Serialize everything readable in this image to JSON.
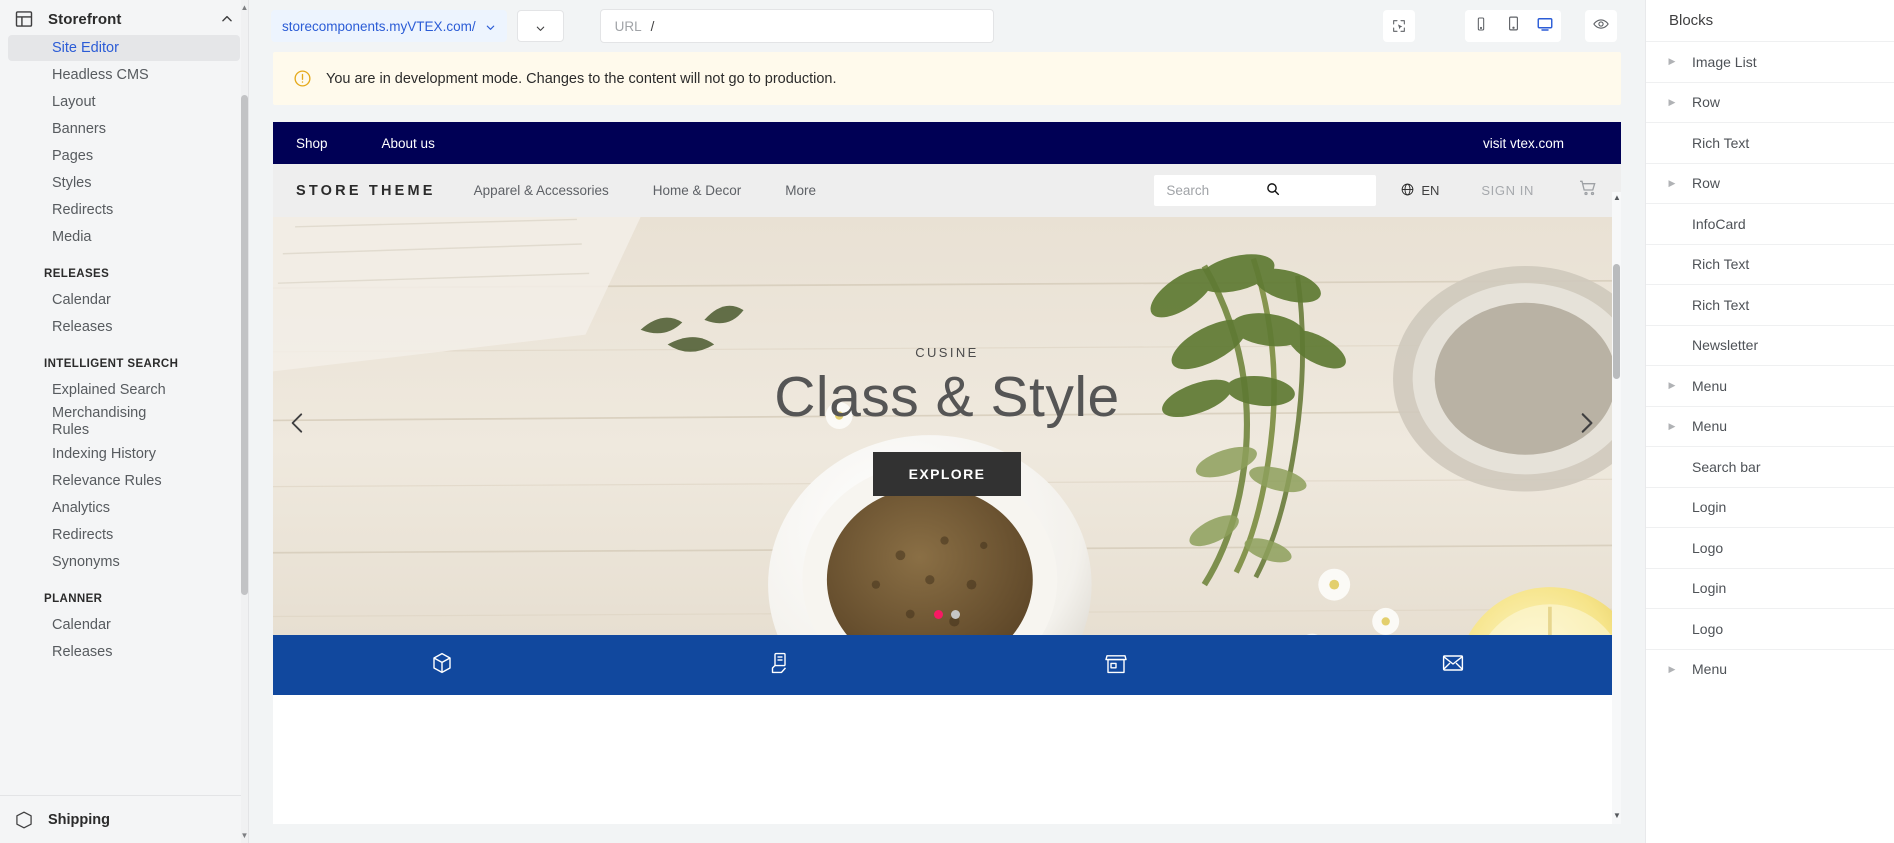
{
  "sidebar": {
    "header": {
      "title": "Storefront",
      "icon": "layout-icon",
      "collapse_icon": "chevron-up-icon"
    },
    "items": [
      {
        "label": "Site Editor",
        "active": true
      },
      {
        "label": "Headless CMS",
        "active": false
      },
      {
        "label": "Layout",
        "active": false
      },
      {
        "label": "Banners",
        "active": false
      },
      {
        "label": "Pages",
        "active": false
      },
      {
        "label": "Styles",
        "active": false
      },
      {
        "label": "Redirects",
        "active": false
      },
      {
        "label": "Media",
        "active": false
      }
    ],
    "groups": [
      {
        "title": "RELEASES",
        "items": [
          {
            "label": "Calendar"
          },
          {
            "label": "Releases"
          }
        ]
      },
      {
        "title": "INTELLIGENT SEARCH",
        "items": [
          {
            "label": "Explained Search"
          },
          {
            "label": "Merchandising Rules"
          },
          {
            "label": "Indexing History"
          },
          {
            "label": "Relevance Rules"
          },
          {
            "label": "Analytics"
          },
          {
            "label": "Redirects"
          },
          {
            "label": "Synonyms"
          }
        ]
      },
      {
        "title": "PLANNER",
        "items": [
          {
            "label": "Calendar"
          },
          {
            "label": "Releases"
          }
        ]
      }
    ],
    "bottom": {
      "label": "Shipping",
      "icon": "box-icon"
    }
  },
  "toolbar": {
    "store_account": "storecomponents.myVTEX.com/",
    "store_account_caret": "chevron-down-icon",
    "workspace_caret": "chevron-down-icon",
    "url_label": "URL",
    "url_value": "/",
    "url_placeholder": "URL",
    "select_tool_icon": "cursor-select-icon",
    "devices": [
      {
        "name": "phone-icon",
        "label": "Phone",
        "active": false
      },
      {
        "name": "tablet-icon",
        "label": "Tablet",
        "active": false
      },
      {
        "name": "desktop-icon",
        "label": "Desktop",
        "active": true
      }
    ],
    "preview_icon": "eye-icon",
    "accent_color": "#2b5cd6"
  },
  "dev_banner": {
    "icon": "warning-circle-icon",
    "text": "You are in development mode. Changes to the content will not go to production.",
    "bg_color": "#fffaec",
    "icon_color": "#e5a91a"
  },
  "preview": {
    "topnav": {
      "links": [
        "Shop",
        "About us"
      ],
      "right_link": "visit vtex.com",
      "bg_color": "#000055"
    },
    "header": {
      "brand": "STORE THEME",
      "nav": [
        "Apparel & Accessories",
        "Home & Decor",
        "More"
      ],
      "search_placeholder": "Search",
      "search_icon": "search-icon",
      "language": "EN",
      "globe_icon": "globe-icon",
      "sign_in": "SIGN IN",
      "cart_icon": "shopping-cart-icon"
    },
    "hero": {
      "kicker": "CUSINE",
      "title": "Class & Style",
      "cta": "EXPLORE",
      "prev_icon": "chevron-left-icon",
      "next_icon": "chevron-right-icon",
      "dots": [
        {
          "active": true
        },
        {
          "active": false
        }
      ],
      "active_dot_color": "#f71963"
    },
    "shelf": {
      "bg_color": "#11489e",
      "icons": [
        "package-icon",
        "hand-card-icon",
        "store-icon",
        "mail-icon"
      ]
    }
  },
  "blocks_panel": {
    "title": "Blocks",
    "items": [
      {
        "label": "Image List",
        "expandable": true
      },
      {
        "label": "Row",
        "expandable": true
      },
      {
        "label": "Rich Text",
        "expandable": false
      },
      {
        "label": "Row",
        "expandable": true
      },
      {
        "label": "InfoCard",
        "expandable": false
      },
      {
        "label": "Rich Text",
        "expandable": false
      },
      {
        "label": "Rich Text",
        "expandable": false
      },
      {
        "label": "Newsletter",
        "expandable": false
      },
      {
        "label": "Menu",
        "expandable": true
      },
      {
        "label": "Menu",
        "expandable": true
      },
      {
        "label": "Search bar",
        "expandable": false
      },
      {
        "label": "Login",
        "expandable": false
      },
      {
        "label": "Logo",
        "expandable": false
      },
      {
        "label": "Login",
        "expandable": false
      },
      {
        "label": "Logo",
        "expandable": false
      },
      {
        "label": "Menu",
        "expandable": true
      }
    ]
  }
}
